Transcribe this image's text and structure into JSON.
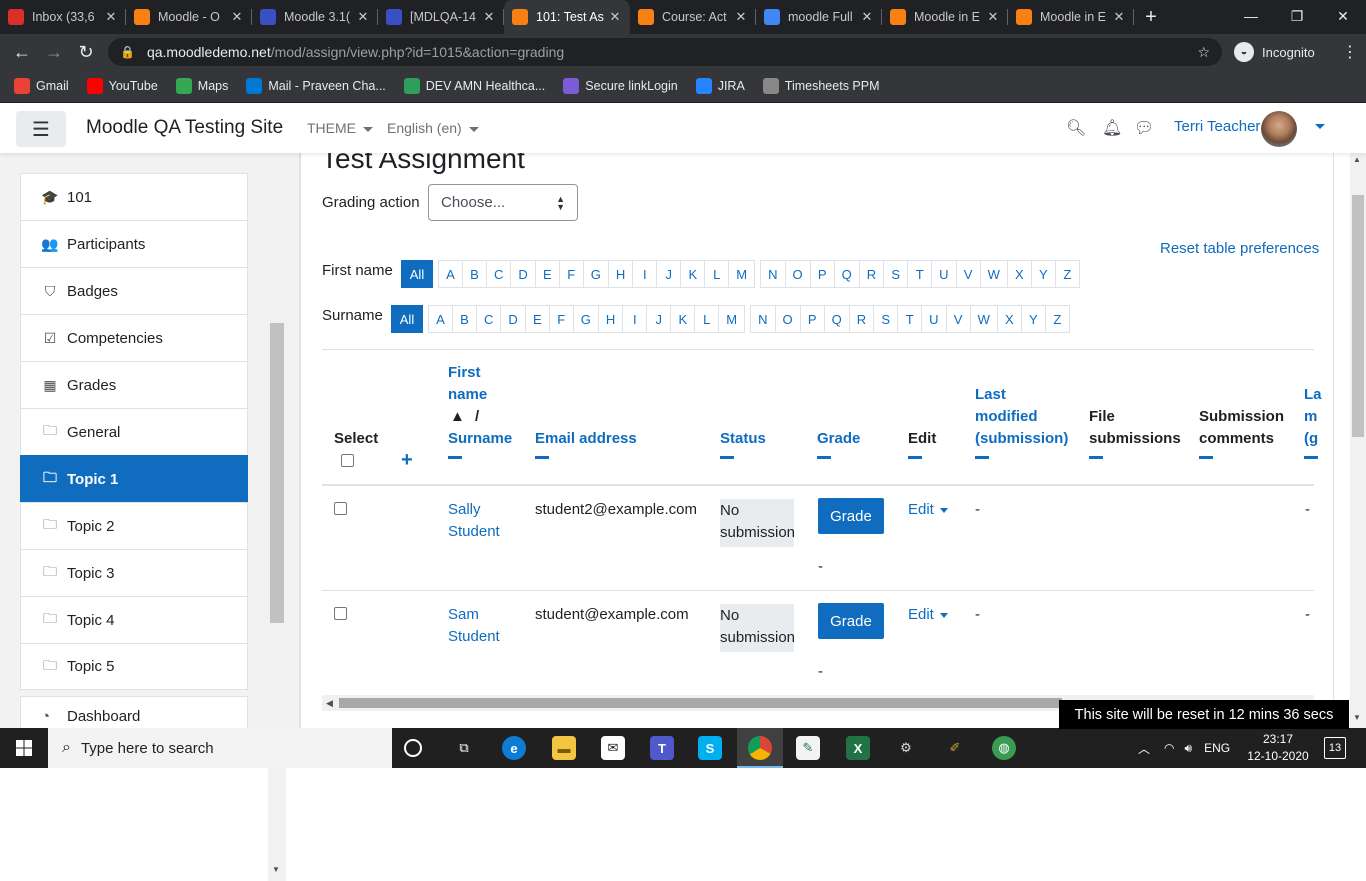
{
  "browser": {
    "tabs": [
      {
        "title": "Inbox (33,6",
        "favicon": "gmail-icon",
        "color": "#d93025",
        "active": false
      },
      {
        "title": "Moodle - O",
        "favicon": "moodle-icon",
        "color": "#f98012",
        "active": false
      },
      {
        "title": "Moodle 3.1(",
        "favicon": "moodle-tracker-icon",
        "color": "#3a4fc4",
        "active": false
      },
      {
        "title": "[MDLQA-14",
        "favicon": "moodle-tracker-icon",
        "color": "#3a4fc4",
        "active": false
      },
      {
        "title": "101: Test As",
        "favicon": "moodle-icon",
        "color": "#f98012",
        "active": true
      },
      {
        "title": "Course: Act",
        "favicon": "moodle-icon",
        "color": "#f98012",
        "active": false
      },
      {
        "title": "moodle Full",
        "favicon": "google-icon",
        "color": "#4285f4",
        "active": false
      },
      {
        "title": "Moodle in E",
        "favicon": "moodle-icon",
        "color": "#f98012",
        "active": false
      },
      {
        "title": "Moodle in E",
        "favicon": "moodle-icon",
        "color": "#f98012",
        "active": false
      }
    ],
    "url_domain": "qa.moodledemo.net",
    "url_path": "/mod/assign/view.php?id=1015&action=grading",
    "incognito_label": "Incognito",
    "bookmarks": [
      {
        "label": "Gmail",
        "color": "#ea4335"
      },
      {
        "label": "YouTube",
        "color": "#ff0000"
      },
      {
        "label": "Maps",
        "color": "#34a853"
      },
      {
        "label": "Mail - Praveen Cha...",
        "color": "#0078d4"
      },
      {
        "label": "DEV AMN Healthca...",
        "color": "#2e9e5b"
      },
      {
        "label": "Secure linkLogin",
        "color": "#7b5cd6"
      },
      {
        "label": "JIRA",
        "color": "#2684ff"
      },
      {
        "label": "Timesheets PPM",
        "color": "#888888"
      }
    ]
  },
  "navbar": {
    "site_name": "Moodle QA Testing Site",
    "theme_label": "THEME",
    "language_label": "English (en)",
    "user_name": "Terri Teacher"
  },
  "drawer": {
    "items": [
      {
        "label": "101",
        "icon": "graduation-cap-icon",
        "glyph": "🎓",
        "active": false
      },
      {
        "label": "Participants",
        "icon": "users-icon",
        "glyph": "👥",
        "active": false
      },
      {
        "label": "Badges",
        "icon": "shield-icon",
        "glyph": "⛉",
        "active": false
      },
      {
        "label": "Competencies",
        "icon": "checkbox-icon",
        "glyph": "☑",
        "active": false
      },
      {
        "label": "Grades",
        "icon": "table-icon",
        "glyph": "▦",
        "active": false
      },
      {
        "label": "General",
        "icon": "folder-icon",
        "glyph": "🗀",
        "active": false
      },
      {
        "label": "Topic 1",
        "icon": "folder-icon",
        "glyph": "🗀",
        "active": true
      },
      {
        "label": "Topic 2",
        "icon": "folder-icon",
        "glyph": "🗀",
        "active": false
      },
      {
        "label": "Topic 3",
        "icon": "folder-icon",
        "glyph": "🗀",
        "active": false
      },
      {
        "label": "Topic 4",
        "icon": "folder-icon",
        "glyph": "🗀",
        "active": false
      },
      {
        "label": "Topic 5",
        "icon": "folder-icon",
        "glyph": "🗀",
        "active": false
      }
    ],
    "dashboard_label": "Dashboard"
  },
  "main": {
    "heading": "Test Assignment",
    "grading_action_label": "Grading action",
    "grading_action_value": "Choose...",
    "reset_link": "Reset table preferences",
    "firstname_label": "First name",
    "surname_label": "Surname",
    "initials_all": "All",
    "initials": [
      "A",
      "B",
      "C",
      "D",
      "E",
      "F",
      "G",
      "H",
      "I",
      "J",
      "K",
      "L",
      "M",
      "N",
      "O",
      "P",
      "Q",
      "R",
      "S",
      "T",
      "U",
      "V",
      "W",
      "X",
      "Y",
      "Z"
    ],
    "columns": {
      "select": "Select",
      "first_name_1": "First",
      "first_name_2": "name",
      "sort_sep": "/",
      "surname": "Surname",
      "email": "Email address",
      "status": "Status",
      "grade": "Grade",
      "edit": "Edit",
      "last_modified_1": "Last",
      "last_modified_2": "modified",
      "last_modified_3": "(submission)",
      "file_1": "File",
      "file_2": "submissions",
      "comments_1": "Submission",
      "comments_2": "comments",
      "last_grade_1": "La",
      "last_grade_2": "m",
      "last_grade_3": "(g"
    },
    "rows": [
      {
        "first": "Sally",
        "last": "Student",
        "email": "student2@example.com",
        "status_1": "No",
        "status_2": "submission",
        "grade_button": "Grade",
        "grade_value": "-",
        "edit": "Edit",
        "modified": "-",
        "last_col": "-"
      },
      {
        "first": "Sam",
        "last": "Student",
        "email": "student@example.com",
        "status_1": "No",
        "status_2": "submission",
        "grade_button": "Grade",
        "grade_value": "-",
        "edit": "Edit",
        "modified": "-",
        "last_col": "-"
      }
    ],
    "reset_notice": "This site will be reset in 12 mins 36 secs"
  },
  "taskbar": {
    "search_placeholder": "Type here to search",
    "language": "ENG",
    "time": "23:17",
    "date": "12-10-2020",
    "notifications": "13"
  }
}
